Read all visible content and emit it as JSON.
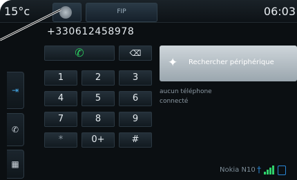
{
  "topbar": {
    "temperature": "15°c",
    "radio_label": "FIP",
    "clock": "06:03"
  },
  "phone": {
    "number": "+330612458978",
    "keys": [
      "1",
      "2",
      "3",
      "4",
      "5",
      "6",
      "7",
      "8",
      "9",
      "*",
      "0+",
      "#"
    ],
    "call_icon": "call-icon",
    "delete_icon": "backspace-icon"
  },
  "bluetooth": {
    "search_label": "Rechercher périphérique",
    "status_line1": "aucun téléphone",
    "status_line2": "connecté"
  },
  "status_bar": {
    "device_name": "Nokia N10"
  },
  "sidebar": {
    "items": [
      "enter-icon",
      "phone-menu-icon",
      "contacts-icon"
    ]
  },
  "colors": {
    "accent_blue": "#2a88d8",
    "call_green": "#2bd05f",
    "signal_green": "#2fd16b"
  }
}
